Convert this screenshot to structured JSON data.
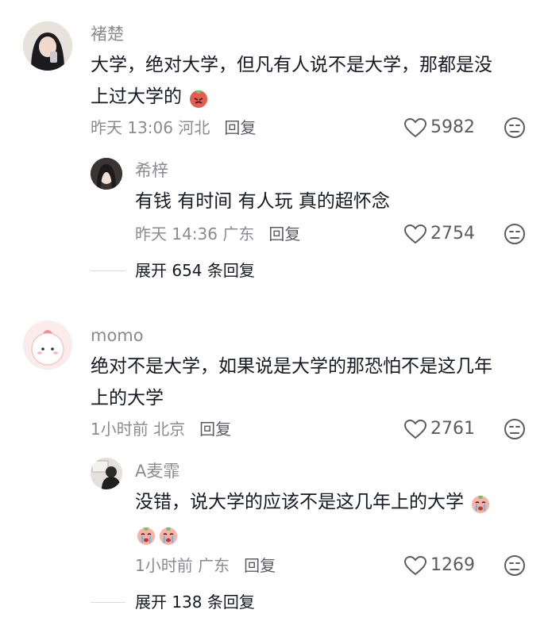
{
  "comments": [
    {
      "author": "褚楚",
      "text": "大学，绝对大学，但凡有人说不是大学，那都是没",
      "text2": "上过大学的",
      "time": "昨天 13:06",
      "location": "河北",
      "reply": "回复",
      "likes": "5982",
      "reply_item": {
        "author": "希梓",
        "text": "有钱 有时间 有人玩 真的超怀念",
        "time": "昨天 14:36",
        "location": "广东",
        "reply": "回复",
        "likes": "2754"
      },
      "expand": "展开 654 条回复"
    },
    {
      "author": "momo",
      "text": "绝对不是大学，如果说是大学的那恐怕不是这几年",
      "text2": "上的大学",
      "time": "1小时前",
      "location": "北京",
      "reply": "回复",
      "likes": "2761",
      "reply_item": {
        "author": "A麦霏",
        "text": "没错，说大学的应该不是这几年上的大学",
        "time": "1小时前",
        "location": "广东",
        "reply": "回复",
        "likes": "1269"
      },
      "expand": "展开 138 条回复"
    }
  ],
  "icons": {
    "like": "heart-outline-icon",
    "dislike": "dislike-face-icon"
  }
}
